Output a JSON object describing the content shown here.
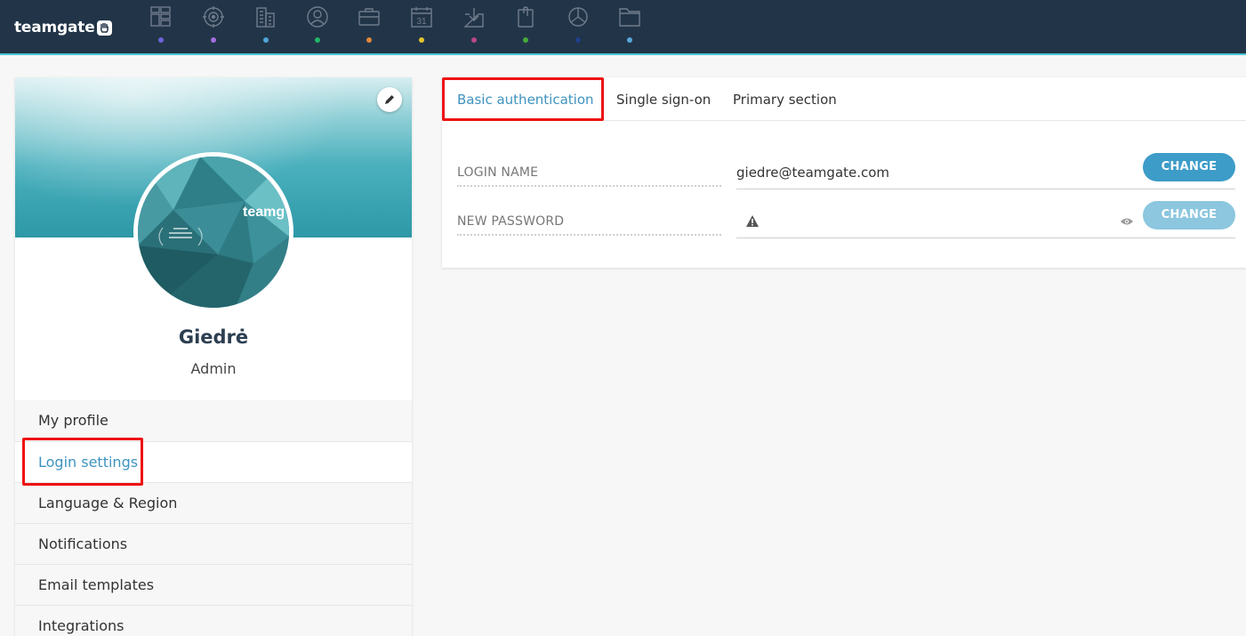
{
  "app": {
    "logo_text": "teamgate",
    "nav": [
      {
        "icon": "dashboard-icon",
        "dot": "#6f63d9"
      },
      {
        "icon": "target-icon",
        "dot": "#a56ee0"
      },
      {
        "icon": "companies-icon",
        "dot": "#4fa5d8"
      },
      {
        "icon": "people-icon",
        "dot": "#21b665"
      },
      {
        "icon": "deals-briefcase-icon",
        "dot": "#e0883a"
      },
      {
        "icon": "calendar-icon",
        "dot": "#e5c52b"
      },
      {
        "icon": "inbox-icon",
        "dot": "#b7478c"
      },
      {
        "icon": "attachments-icon",
        "dot": "#46ab3a"
      },
      {
        "icon": "reports-pie-icon",
        "dot": "#1e3f8a"
      },
      {
        "icon": "folder-icon",
        "dot": "#59a7d9"
      }
    ],
    "calendar_day": "31"
  },
  "profile": {
    "name": "Giedrė",
    "role": "Admin",
    "avatar_brand": "teamg"
  },
  "sidebar": {
    "items": [
      {
        "label": "My profile"
      },
      {
        "label": "Login settings"
      },
      {
        "label": "Language & Region"
      },
      {
        "label": "Notifications"
      },
      {
        "label": "Email templates"
      },
      {
        "label": "Integrations"
      }
    ]
  },
  "tabs": [
    {
      "label": "Basic authentication"
    },
    {
      "label": "Single sign-on"
    },
    {
      "label": "Primary section"
    }
  ],
  "login": {
    "name_label": "LOGIN NAME",
    "name_value": "giedre@teamgate.com",
    "password_label": "NEW PASSWORD",
    "change_label": "CHANGE"
  },
  "colors": {
    "accent": "#3e93c0",
    "topbar": "#223548",
    "highlight": "#ee1111"
  }
}
